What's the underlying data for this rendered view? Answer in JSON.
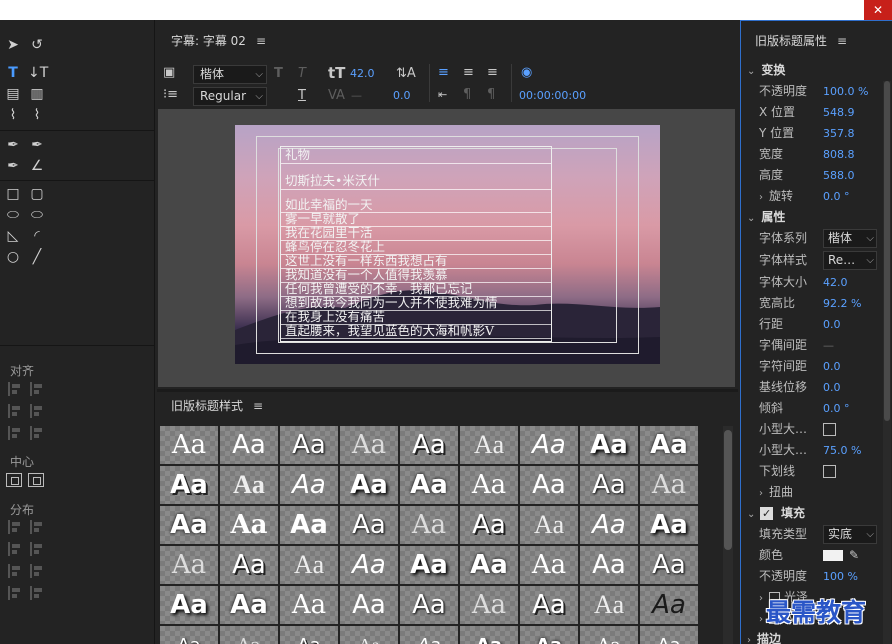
{
  "window": {
    "close_glyph": "✕"
  },
  "tools_panel": {
    "align_label": "对齐",
    "center_label": "中心",
    "distribute_label": "分布"
  },
  "title_panel": {
    "title": "字幕: 字幕 02",
    "font_family": "楷体",
    "font_style": "Regular",
    "font_size": "42.0",
    "kerning": "—",
    "tracking": "0.0",
    "timecode": "00:00:00:00",
    "subtitle_lines": [
      "礼物",
      "切斯拉夫•米沃什",
      "如此幸福的一天",
      "雾一早就散了",
      "我在花园里干活",
      "蜂鸟停在忍冬花上",
      "这世上没有一样东西我想占有",
      "我知道没有一个人值得我羡慕",
      "任何我曾遭受的不幸，我都已忘记",
      "想到故我今我同为一人并不使我难为情",
      "在我身上没有痛苦",
      "直起腰来，我望见蓝色的大海和帆影V"
    ]
  },
  "styles_panel": {
    "title": "旧版标题样式",
    "sample": "Aa"
  },
  "properties_panel": {
    "title": "旧版标题属性",
    "transform": {
      "section": "变换",
      "opacity_label": "不透明度",
      "opacity": "100.0 %",
      "x_label": "X 位置",
      "x": "548.9",
      "y_label": "Y 位置",
      "y": "357.8",
      "width_label": "宽度",
      "width": "808.8",
      "height_label": "高度",
      "height": "588.0",
      "rotation_label": "旋转",
      "rotation": "0.0 °"
    },
    "properties": {
      "section": "属性",
      "font_family_label": "字体系列",
      "font_family": "楷体",
      "font_style_label": "字体样式",
      "font_style": "Re…",
      "font_size_label": "字体大小",
      "font_size": "42.0",
      "aspect_label": "宽高比",
      "aspect": "92.2 %",
      "leading_label": "行距",
      "leading": "0.0",
      "kerning_label": "字偶间距",
      "kerning": "—",
      "tracking_label": "字符间距",
      "tracking": "0.0",
      "baseline_label": "基线位移",
      "baseline": "0.0",
      "slant_label": "倾斜",
      "slant": "0.0 °",
      "smallcaps_label": "小型大…",
      "smallcaps_size_label": "小型大…",
      "smallcaps_size": "75.0 %",
      "underline_label": "下划线",
      "distort_label": "扭曲"
    },
    "fill": {
      "section": "填充",
      "type_label": "填充类型",
      "type": "实底",
      "color_label": "颜色",
      "color": "#f2f2f2",
      "opacity_label": "不透明度",
      "opacity": "100 %",
      "sheen_label": "光泽",
      "texture_label": "纹理"
    },
    "strokes_section": "描边"
  },
  "watermark": "最需教育"
}
